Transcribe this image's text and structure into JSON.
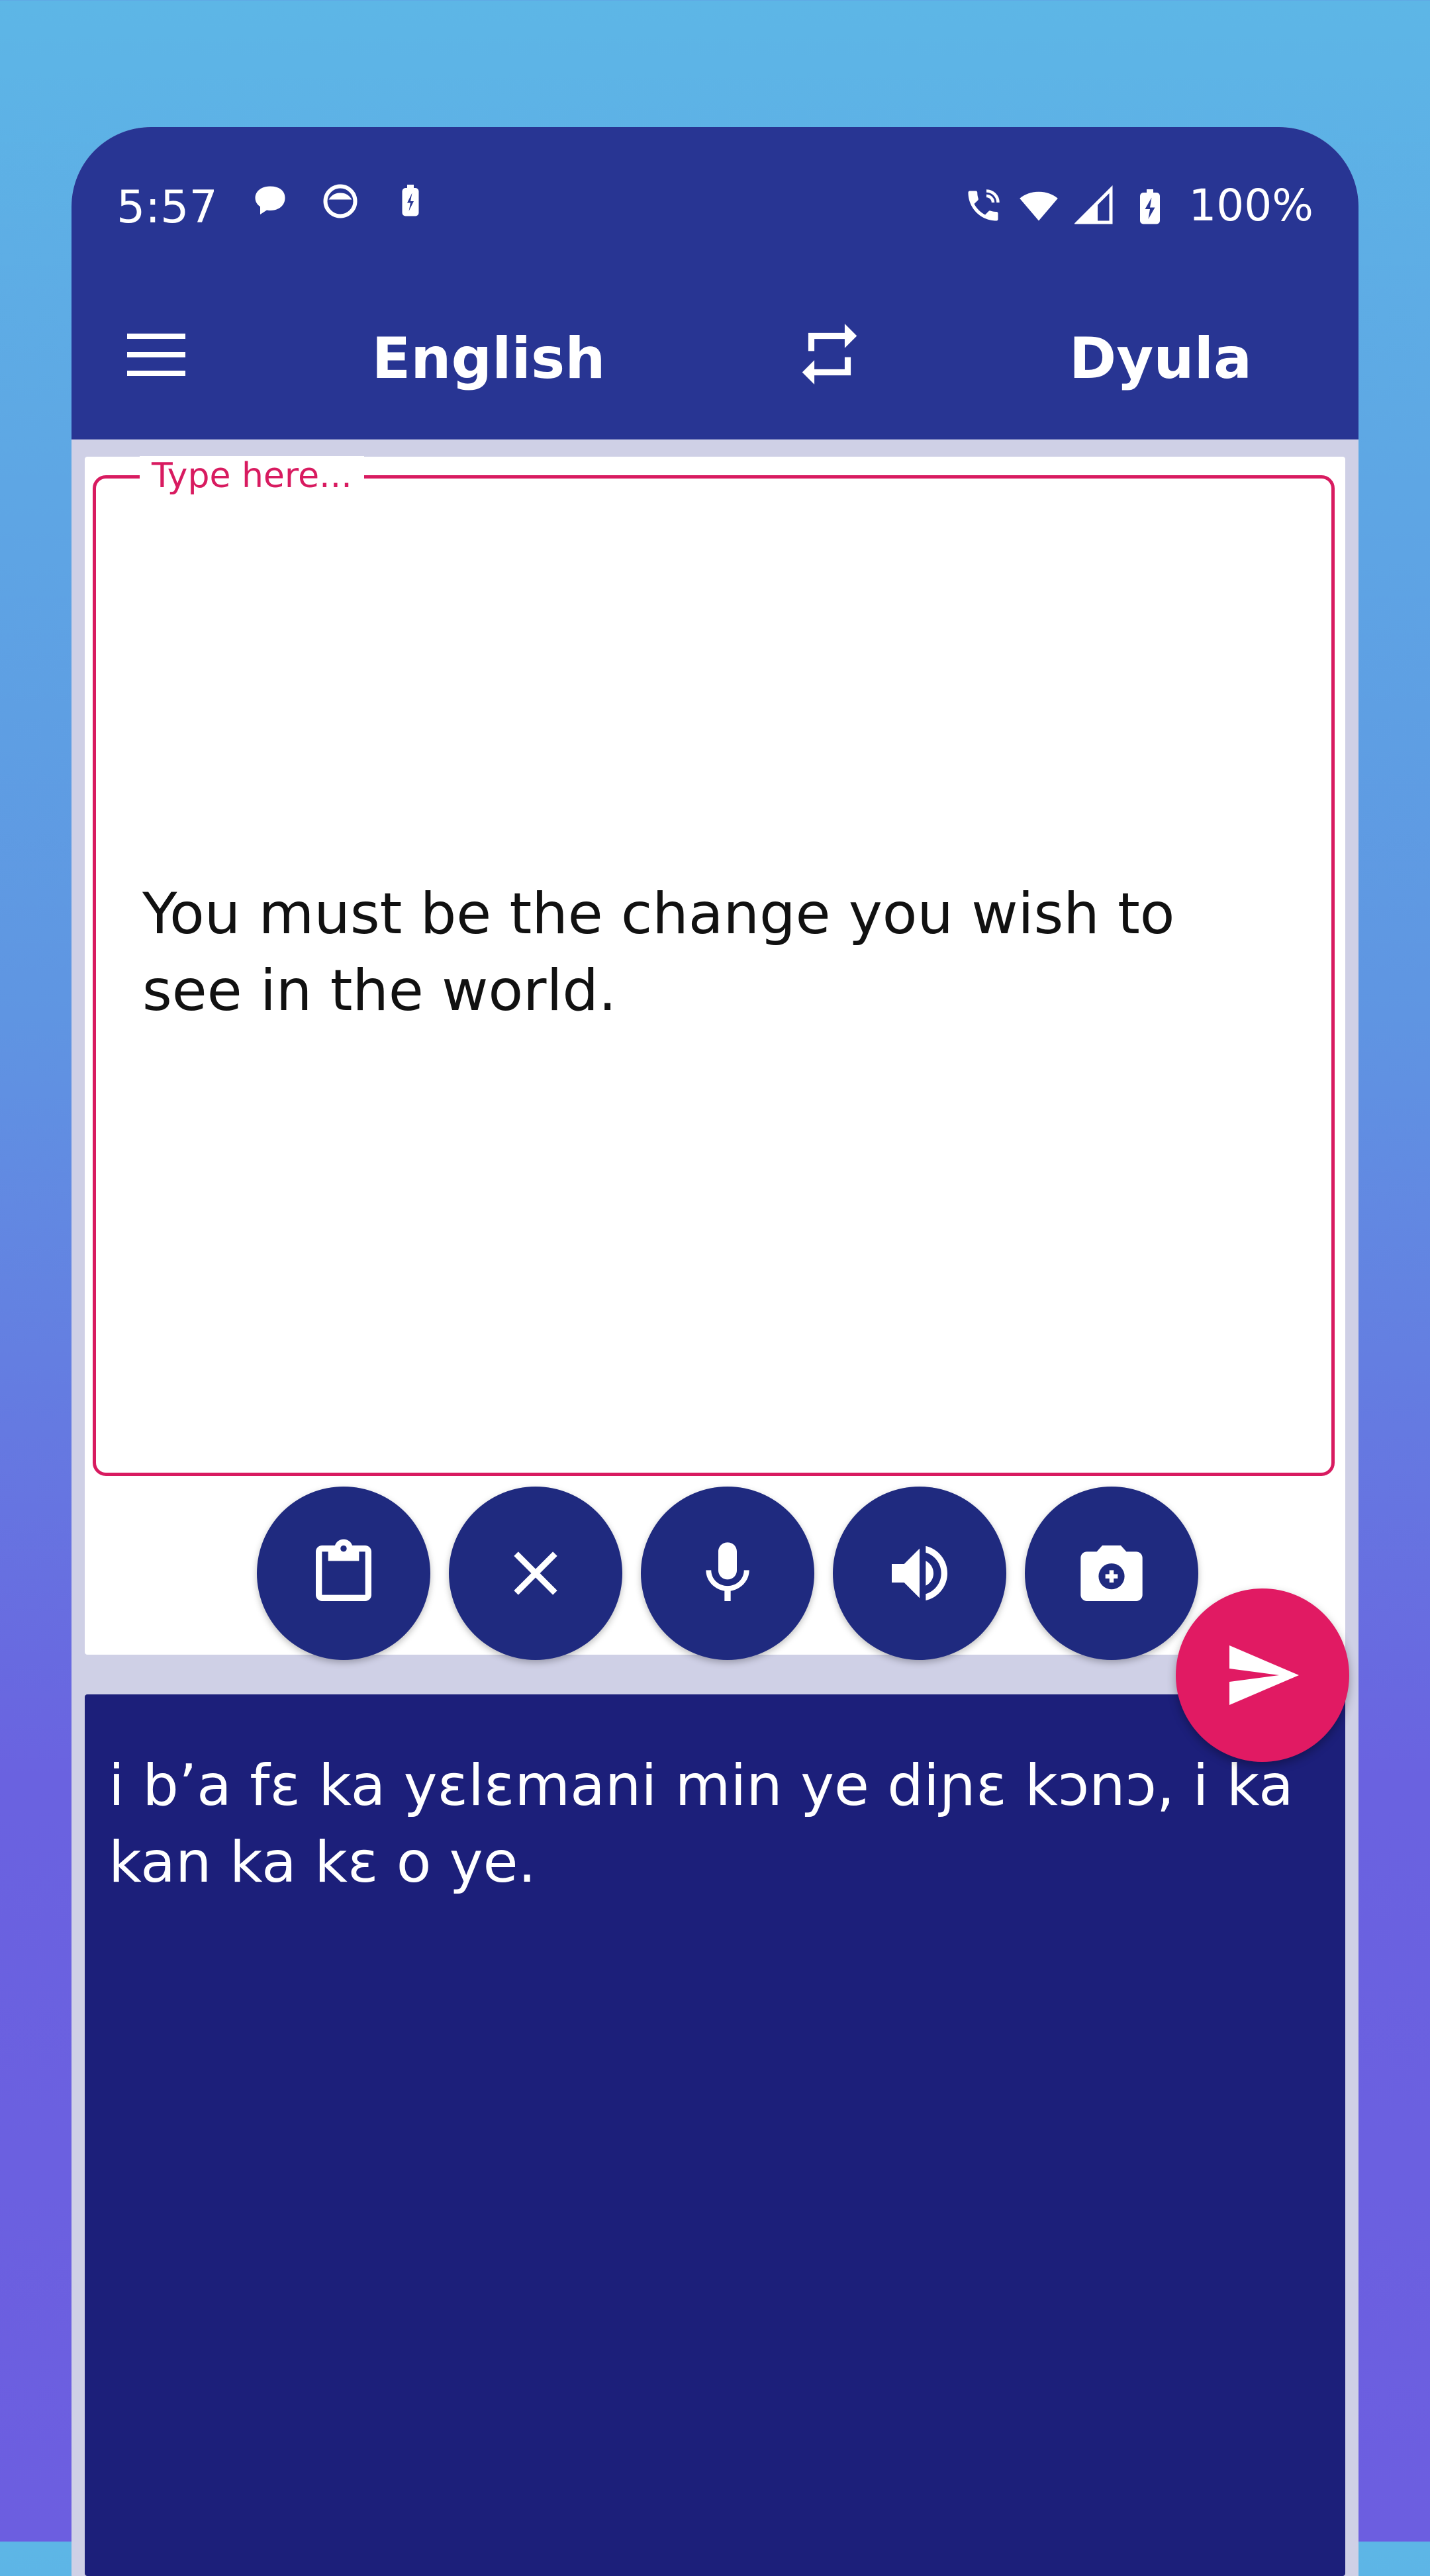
{
  "status_bar": {
    "time": "5:57",
    "left_icons": [
      "chat-bubble-icon",
      "messenger-icon",
      "battery-saver-icon"
    ],
    "right_icons": [
      "wifi-calling-icon",
      "wifi-icon",
      "signal-icon",
      "battery-charging-icon"
    ],
    "battery": "100%"
  },
  "app_bar": {
    "source_language": "English",
    "target_language": "Dyula",
    "menu_icon": "menu-icon",
    "swap_icon": "swap-icon"
  },
  "input": {
    "label": "Type here...",
    "text": "You must be the change you wish to see in the world."
  },
  "tools": [
    {
      "name": "paste",
      "icon": "clipboard-icon"
    },
    {
      "name": "clear",
      "icon": "close-icon"
    },
    {
      "name": "voice-input",
      "icon": "microphone-icon"
    },
    {
      "name": "speak",
      "icon": "speaker-icon"
    },
    {
      "name": "camera",
      "icon": "camera-icon"
    }
  ],
  "send_icon": "send-icon",
  "output": {
    "text": "i b’a fɛ ka yɛlɛmani min ye diɲɛ kɔnɔ, i ka kan ka kɛ o ye."
  },
  "colors": {
    "primary": "#283593",
    "output_bg": "#1c1f7a",
    "accent": "#e11a63"
  }
}
